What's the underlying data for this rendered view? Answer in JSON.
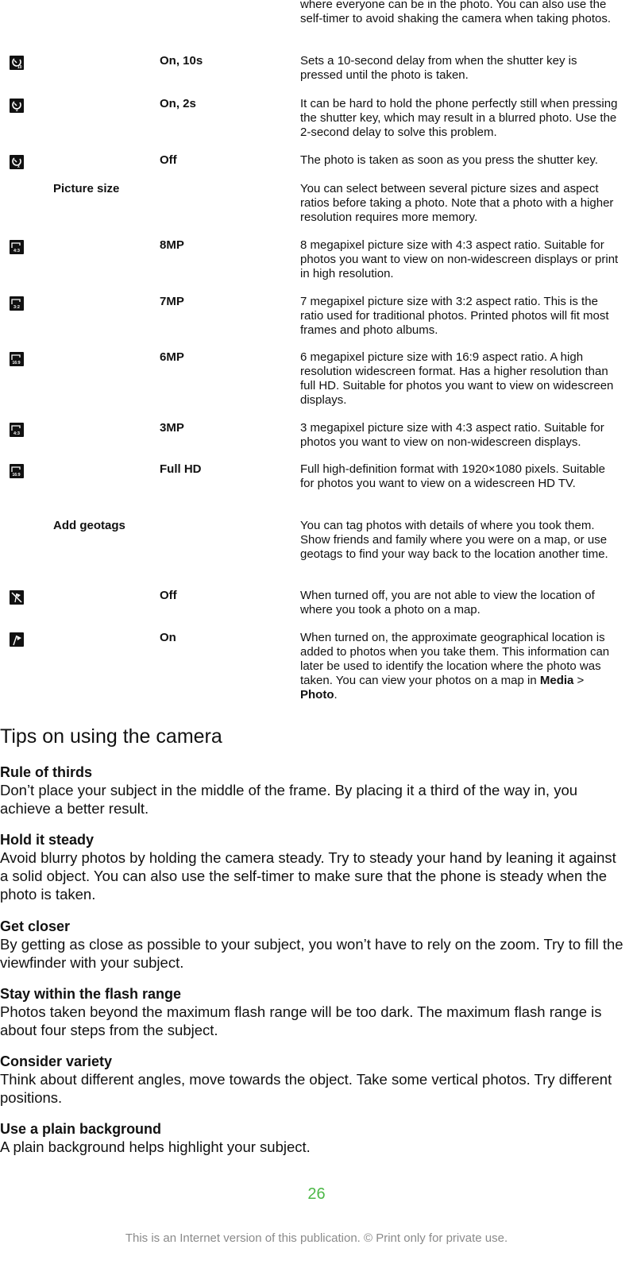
{
  "table": {
    "continued_desc": "where everyone can be in the photo. You can also use the self-timer to avoid shaking the camera when taking photos.",
    "rows": [
      {
        "icon": "self-timer-10s-icon",
        "icon_label": "10",
        "option": "On, 10s",
        "desc": "Sets a 10-second delay from when the shutter key is pressed until the photo is taken."
      },
      {
        "icon": "self-timer-2s-icon",
        "icon_label": "2",
        "option": "On, 2s",
        "desc": "It can be hard to hold the phone perfectly still when pressing the shutter key, which may result in a blurred photo. Use the 2-second delay to solve this problem."
      },
      {
        "icon": "self-timer-off-icon",
        "icon_label": "x",
        "option": "Off",
        "desc": "The photo is taken as soon as you press the shutter key."
      },
      {
        "setting": "Picture size",
        "desc": "You can select between several picture sizes and aspect ratios before taking a photo. Note that a photo with a higher resolution requires more memory."
      },
      {
        "icon": "picture-size-4-3-icon",
        "icon_label": "4:3",
        "option": "8MP",
        "desc": "8 megapixel picture size with 4:3 aspect ratio. Suitable for photos you want to view on non-widescreen displays or print in high resolution."
      },
      {
        "icon": "picture-size-3-2-icon",
        "icon_label": "3:2",
        "option": "7MP",
        "desc": "7 megapixel picture size with 3:2 aspect ratio. This is the ratio used for traditional photos. Printed photos will fit most frames and photo albums."
      },
      {
        "icon": "picture-size-16-9-icon",
        "icon_label": "16:9",
        "option": "6MP",
        "desc": "6 megapixel picture size with 16:9 aspect ratio. A high resolution widescreen format. Has a higher resolution than full HD. Suitable for photos you want to view on widescreen displays."
      },
      {
        "icon": "picture-size-4-3-icon",
        "icon_label": "4:3",
        "option": "3MP",
        "desc": "3 megapixel picture size with 4:3 aspect ratio. Suitable for photos you want to view on non-widescreen displays."
      },
      {
        "icon": "picture-size-16-9-icon",
        "icon_label": "16:9",
        "option": "Full HD",
        "desc": "Full high-definition format with 1920×1080 pixels. Suitable for photos you want to view on a widescreen HD TV."
      },
      {
        "setting": "Add geotags",
        "desc": "You can tag photos with details of where you took them. Show friends and family where you were on a map, or use geotags to find your way back to the location another time."
      },
      {
        "icon": "geotag-off-icon",
        "option": "Off",
        "desc": "When turned off, you are not able to view the location of where you took a photo on a map."
      },
      {
        "icon": "geotag-on-icon",
        "option": "On",
        "desc": "When turned on, the approximate geographical location is added to photos when you take them. This information can later be used to identify the location where the photo was taken. You can view your photos on a map in",
        "desc_path": [
          "Media",
          " > ",
          "Photo",
          "."
        ]
      }
    ]
  },
  "tips": {
    "heading": "Tips on using the camera",
    "items": [
      {
        "title": "Rule of thirds",
        "body": "Don’t place your subject in the middle of the frame. By placing it a third of the way in, you achieve a better result."
      },
      {
        "title": "Hold it steady",
        "body": "Avoid blurry photos by holding the camera steady. Try to steady your hand by leaning it against a solid object. You can also use the self-timer to make sure that the phone is steady when the photo is taken."
      },
      {
        "title": "Get closer",
        "body": "By getting as close as possible to your subject, you won’t have to rely on the zoom. Try to fill the viewfinder with your subject."
      },
      {
        "title": "Stay within the flash range",
        "body": "Photos taken beyond the maximum flash range will be too dark. The maximum flash range is about four steps from the subject."
      },
      {
        "title": "Consider variety",
        "body": "Think about different angles, move towards the object. Take some vertical photos. Try different positions."
      },
      {
        "title": "Use a plain background",
        "body": "A plain background helps highlight your subject."
      }
    ]
  },
  "page_number": "26",
  "footer": "This is an Internet version of this publication. © Print only for private use.",
  "colors": {
    "page_number": "#4cb847",
    "footer": "#8a8a8a"
  }
}
